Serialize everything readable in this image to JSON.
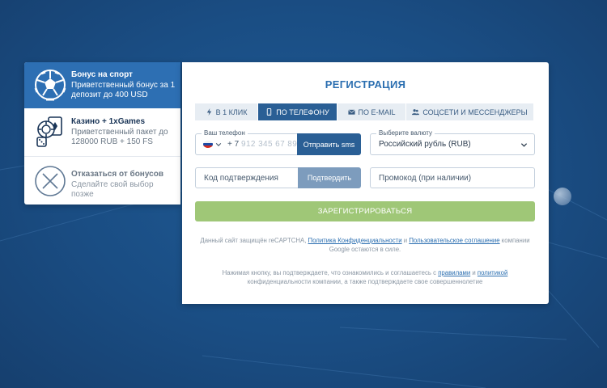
{
  "bonuses": [
    {
      "title": "Бонус на спорт",
      "desc": "Приветственный бонус за 1 депозит до 400 USD",
      "icon": "soccer-ball-icon"
    },
    {
      "title": "Казино + 1xGames",
      "desc": "Приветственный пакет до 128000 RUB + 150 FS",
      "icon": "casino-chips-icon"
    },
    {
      "title": "Отказаться от бонусов",
      "desc": "Сделайте свой выбор позже",
      "icon": "close-circle-icon"
    }
  ],
  "registration": {
    "title": "РЕГИСТРАЦИЯ",
    "tabs": [
      {
        "label": "В 1 КЛИК",
        "icon": "lightning-icon"
      },
      {
        "label": "ПО ТЕЛЕФОНУ",
        "icon": "phone-icon"
      },
      {
        "label": "ПО E-MAIL",
        "icon": "envelope-icon"
      },
      {
        "label": "СОЦСЕТИ И МЕССЕНДЖЕРЫ",
        "icon": "users-icon"
      }
    ],
    "active_tab": "ПО ТЕЛЕФОНУ",
    "phone": {
      "legend": "Ваш телефон",
      "prefix": "+ 7",
      "placeholder": "912 345 67 89",
      "send_sms": "Отправить sms"
    },
    "currency": {
      "legend": "Выберите валюту",
      "value": "Российский рубль (RUB)"
    },
    "code": {
      "placeholder": "Код подтверждения",
      "confirm": "Подтвердить"
    },
    "promo": {
      "placeholder": "Промокод (при наличии)"
    },
    "register_button": "ЗАРЕГИСТРИРОВАТЬСЯ",
    "recaptcha": {
      "pre": "Данный сайт защищён reCAPTCHA, ",
      "link1": "Политика Конфиденциальности",
      "mid": " и ",
      "link2": "Пользовательское соглашение",
      "post": " компании Google остаются в силе."
    },
    "terms": {
      "pre": "Нажимая кнопку, вы подтверждаете, что ознакомились и соглашаетесь с ",
      "link1": "правилами",
      "mid": " и ",
      "link2": "политикой",
      "post": " конфиденциальности компании, а также подтверждаете свое совершеннолетие"
    }
  },
  "colors": {
    "primary": "#2a5f95",
    "accent": "#2a6eb0",
    "register": "#9fc777",
    "background": "#1a4d83"
  }
}
